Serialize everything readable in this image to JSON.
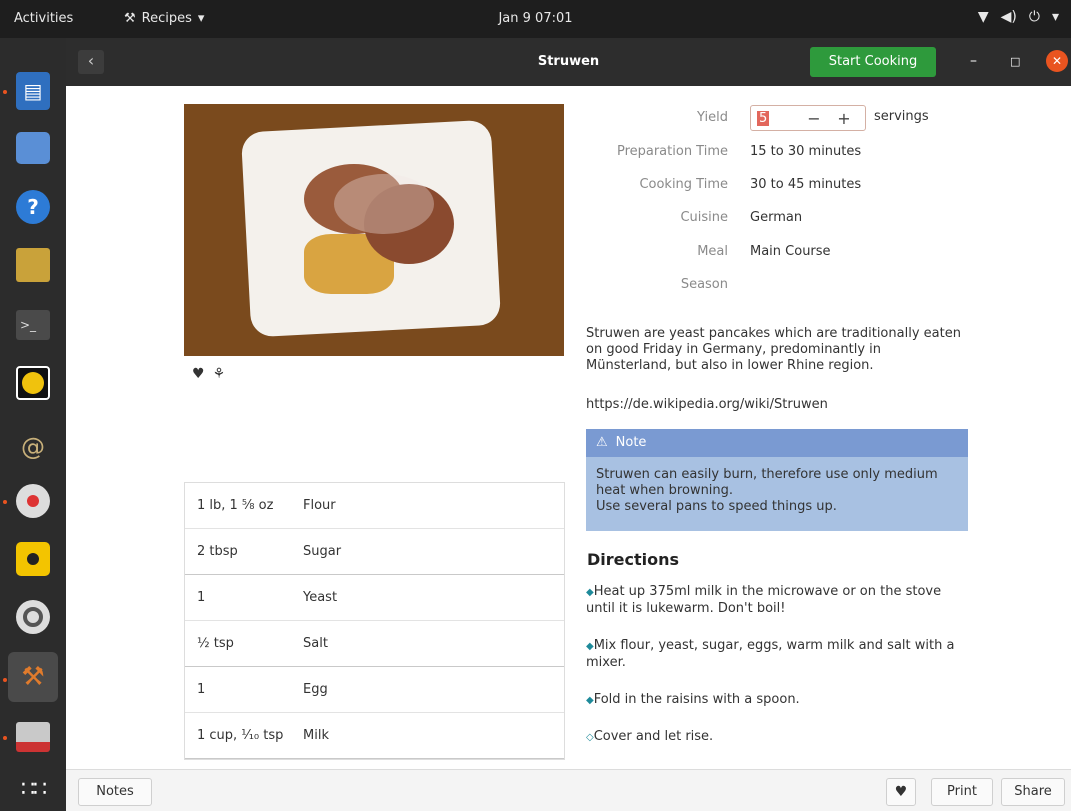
{
  "topbar": {
    "activities": "Activities",
    "app_name": "Recipes",
    "clock": "Jan 9  07:01"
  },
  "window": {
    "title": "Struwen",
    "back_label": "‹",
    "start_cooking": "Start Cooking",
    "minimize": "–",
    "maximize": "□",
    "close": "✕"
  },
  "details": {
    "yield_label": "Yield",
    "yield_value": "5",
    "yield_minus": "−",
    "yield_plus": "+",
    "servings": "servings",
    "prep_label": "Preparation Time",
    "prep_value": "15 to 30 minutes",
    "cook_label": "Cooking Time",
    "cook_value": "30 to 45 minutes",
    "cuisine_label": "Cuisine",
    "cuisine_value": "German",
    "meal_label": "Meal",
    "meal_value": "Main Course",
    "season_label": "Season",
    "season_value": ""
  },
  "description": "Struwen are yeast pancakes which are traditionally eaten on good Friday in Germany, predominantly in Münsterland, but also in lower Rhine region.",
  "source_link": "https://de.wikipedia.org/wiki/Struwen",
  "note": {
    "title": "Note",
    "text": "Struwen can easily burn, therefore use only medium heat when browning.\nUse several pans to speed things up."
  },
  "directions": {
    "title": "Directions",
    "steps": [
      "Heat up 375ml milk in the microwave or on the stove until it is lukewarm. Don't boil!",
      "Mix flour, yeast, sugar, eggs, warm milk and salt with a mixer.",
      "Fold in the raisins with a spoon.",
      "Cover and let rise."
    ]
  },
  "ingredients": [
    {
      "qty": "1 lb, 1 ⅝ oz",
      "name": "Flour"
    },
    {
      "qty": "2 tbsp",
      "name": "Sugar"
    },
    {
      "qty": "1",
      "name": "Yeast"
    },
    {
      "qty": "½ tsp",
      "name": "Salt"
    },
    {
      "qty": "1",
      "name": "Egg"
    },
    {
      "qty": "1 cup, ⅟₁₀ tsp",
      "name": "Milk"
    }
  ],
  "bottombar": {
    "notes": "Notes",
    "favorite": "♥",
    "print": "Print",
    "share": "Share"
  },
  "icons": {
    "doc": "▤",
    "help": "?",
    "terminal": ">_",
    "snail": "@",
    "grid": "∷∷",
    "recipes": "⚒"
  }
}
